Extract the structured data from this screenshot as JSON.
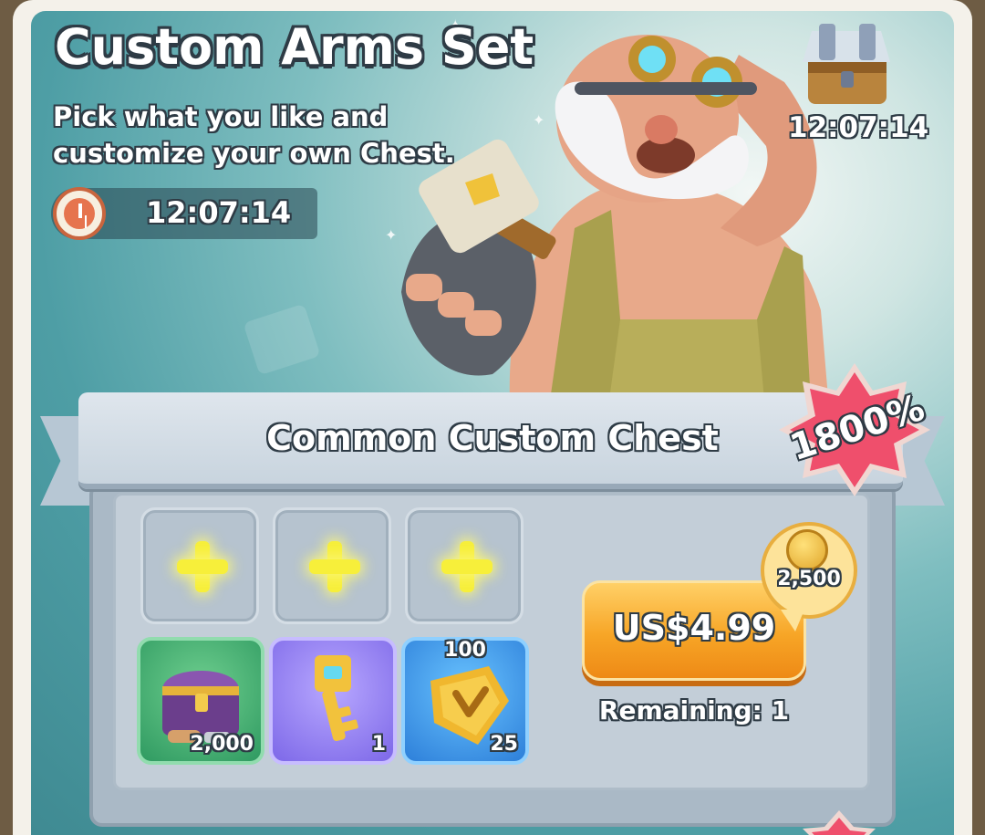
{
  "offer": {
    "title": "Custom Arms Set",
    "subtitle": "Pick what you like and customize your own Chest.",
    "timer": "12:07:14"
  },
  "top_chest": {
    "icon": "chest-icon",
    "timer": "12:07:14"
  },
  "chest_card": {
    "title": "Common Custom Chest",
    "bonus": "1800%",
    "slots": [
      {
        "icon": "plus-icon"
      },
      {
        "icon": "plus-icon"
      },
      {
        "icon": "plus-icon"
      }
    ],
    "items": [
      {
        "icon": "treasure-chest-icon",
        "count": "2,000",
        "color": "#3aa56a"
      },
      {
        "icon": "key-icon",
        "count": "1",
        "color": "#8a76ee"
      },
      {
        "icon": "shield-badge-icon",
        "top_count": "100",
        "count": "25",
        "color": "#3a8fe4"
      }
    ],
    "purchase": {
      "price": "US$4.99",
      "coin_reward": "2,500",
      "remaining": "Remaining: 1"
    }
  },
  "colors": {
    "button": "#f7a526",
    "badge": "#ef4f6c",
    "panel": "#4e9ea5"
  }
}
